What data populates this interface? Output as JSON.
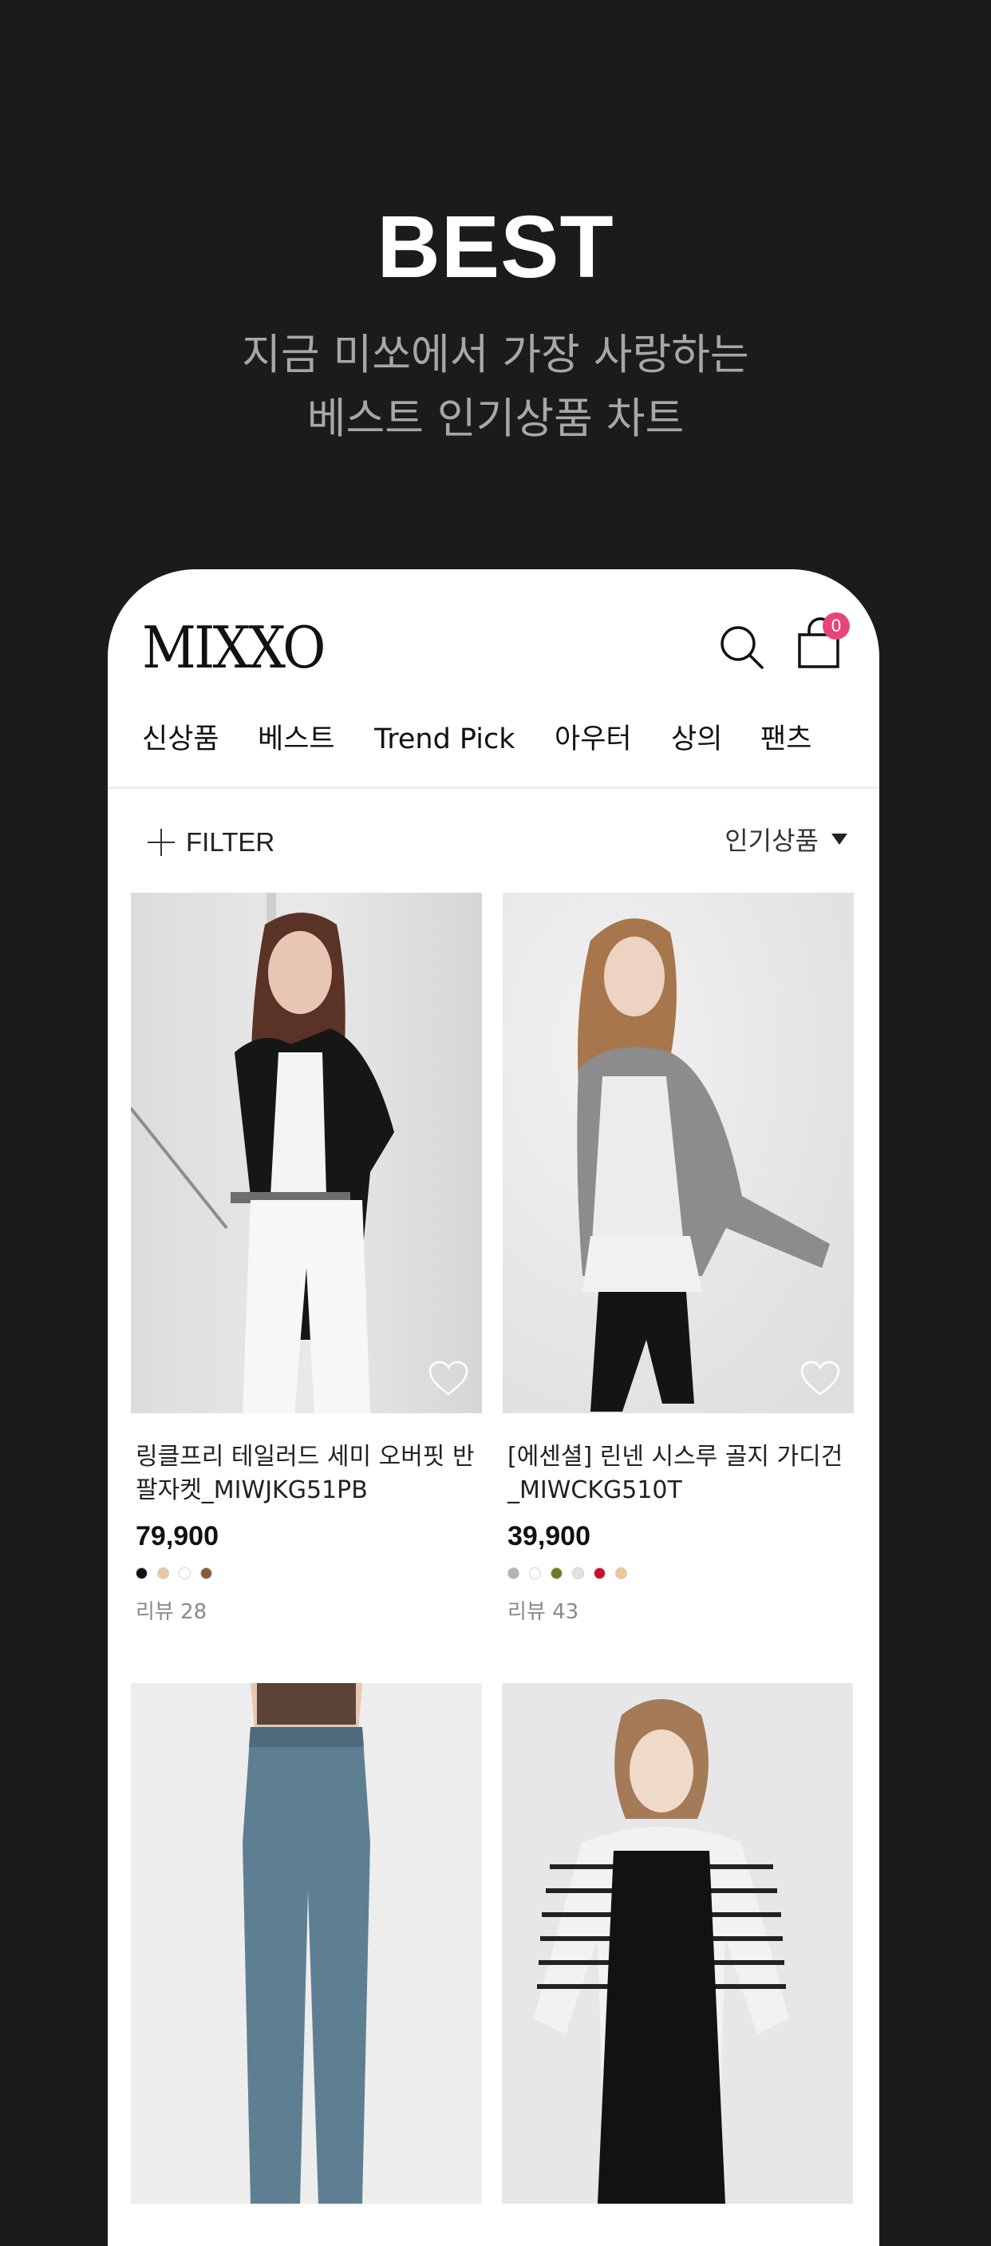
{
  "promo": {
    "title": "BEST",
    "subtitle_line1": "지금 미쏘에서 가장 사랑하는",
    "subtitle_line2": "베스트 인기상품 차트"
  },
  "header": {
    "logo": "MIXXO",
    "cart_count": "0"
  },
  "nav": {
    "items": [
      "신상품",
      "베스트",
      "Trend Pick",
      "아우터",
      "상의",
      "팬츠"
    ]
  },
  "toolbar": {
    "filter_label": "FILTER",
    "sort_label": "인기상품"
  },
  "products": [
    {
      "name_line1": "링클프리 테일러드 세미 오버핏 반",
      "name_line2": "팔자켓_MIWJKG51PB",
      "price": "79,900",
      "reviews": "리뷰 28",
      "colors": [
        "#111111",
        "#e9c9a0",
        "#ffffff",
        "#8a5a3c"
      ]
    },
    {
      "name_line1": "[에센셜] 린넨 시스루 골지 가디건",
      "name_line2": "_MIWCKG510T",
      "price": "39,900",
      "reviews": "리뷰 43",
      "colors": [
        "#b4b4b4",
        "#ffffff",
        "#6f7a1f",
        "#e2e2e2",
        "#c8102e",
        "#f0c890"
      ]
    },
    {
      "name_line1": "",
      "name_line2": "",
      "price": "",
      "reviews": "",
      "colors": []
    },
    {
      "name_line1": "",
      "name_line2": "",
      "price": "",
      "reviews": "",
      "colors": []
    }
  ]
}
